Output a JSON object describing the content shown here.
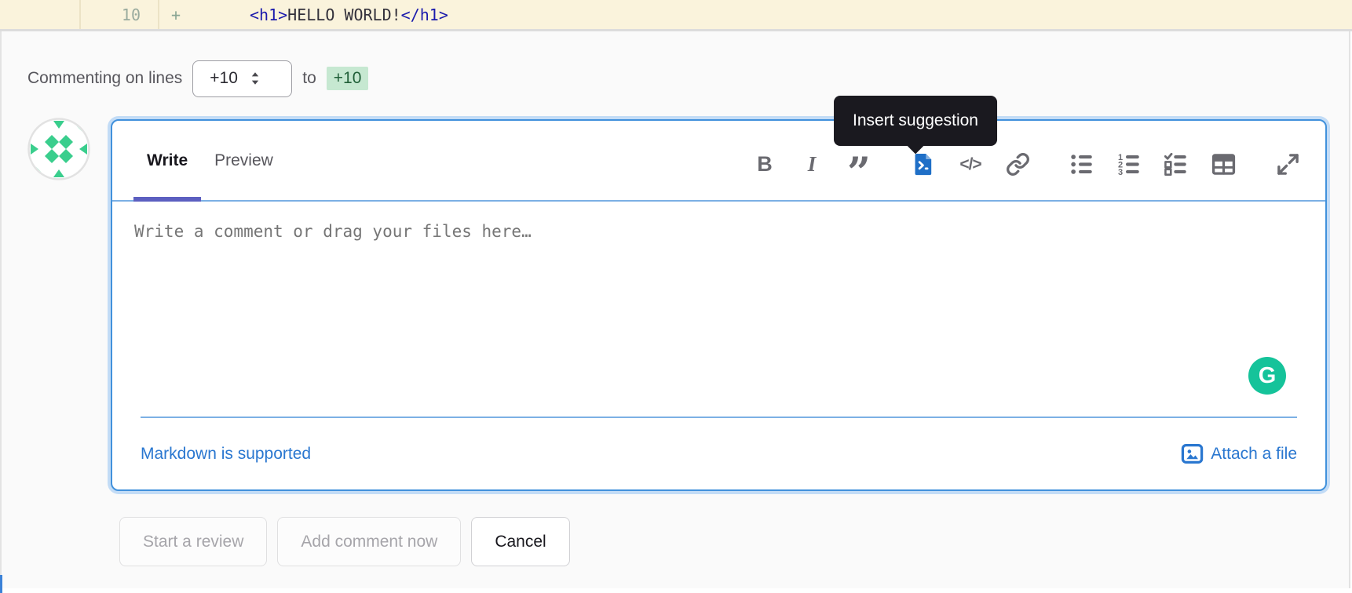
{
  "diff_line": {
    "new_line_number": "10",
    "change_marker": "+",
    "code": {
      "open_tag": "<h1>",
      "text": "HELLO WORLD!",
      "close_tag": "</h1>"
    }
  },
  "comment_header": {
    "label": "Commenting on lines",
    "start_line_value": "+10",
    "connector": "to",
    "end_line_value": "+10"
  },
  "tooltip": {
    "label": "Insert suggestion"
  },
  "editor": {
    "tabs": {
      "write": "Write",
      "preview": "Preview"
    },
    "toolbar": {
      "bold_glyph": "B",
      "italic_glyph": "I",
      "quote_glyph": "”",
      "code_glyph": "</>",
      "icons": [
        "bold",
        "italic",
        "quote",
        "insert-suggestion",
        "code",
        "link",
        "bulleted-list",
        "numbered-list",
        "task-list",
        "table",
        "full-screen"
      ]
    },
    "placeholder": "Write a comment or drag your files here…",
    "footer": {
      "markdown_hint": "Markdown is supported",
      "attach_label": "Attach a file"
    },
    "grammarly_glyph": "G"
  },
  "actions": {
    "start_review": "Start a review",
    "add_comment_now": "Add comment now",
    "cancel": "Cancel"
  },
  "colors": {
    "highlight_cream": "#faf3dc",
    "accent_blue": "#2a77d0",
    "focus_ring": "#c3dcf6",
    "active_tab_indigo": "#5c5fc0",
    "added_line_green_bg": "#c6e8d1",
    "added_line_green_text": "#205f38",
    "suggestion_icon_blue": "#1f6fc7",
    "grammarly_green": "#15c39a",
    "tooltip_bg": "#1a191f"
  }
}
